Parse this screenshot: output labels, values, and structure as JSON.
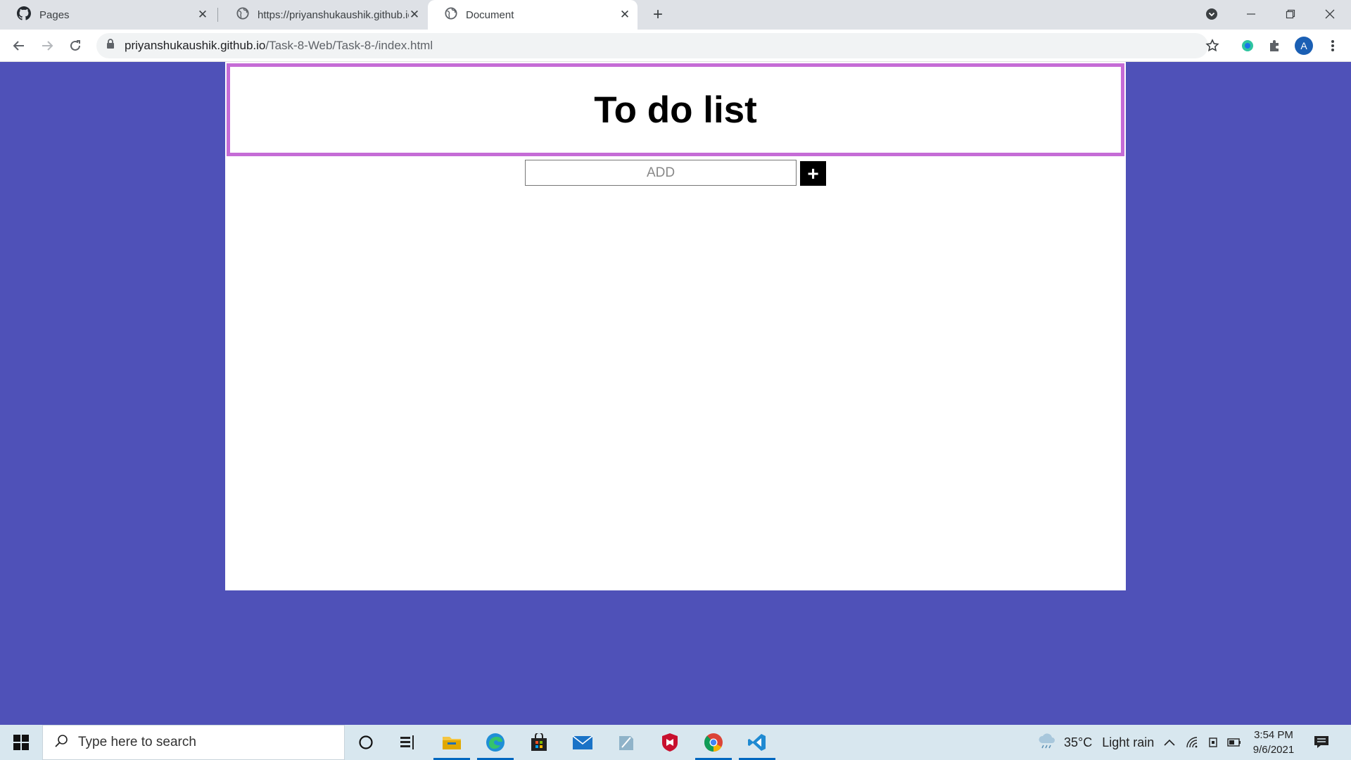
{
  "browser": {
    "tabs": [
      {
        "title": "Pages",
        "icon": "github-icon",
        "active": false
      },
      {
        "title": "https://priyanshukaushik.github.io",
        "icon": "globe-icon",
        "active": false
      },
      {
        "title": "Document",
        "icon": "globe-icon",
        "active": true
      }
    ],
    "url_host": "priyanshukaushik.github.io",
    "url_path": "/Task-8-Web/Task-8-/index.html",
    "profile_initial": "A"
  },
  "page": {
    "title": "To do list",
    "add_placeholder": "ADD",
    "add_button_label": "+",
    "colors": {
      "background": "#4f51b8",
      "header_border": "#c56cd6",
      "button": "#000000"
    }
  },
  "taskbar": {
    "search_placeholder": "Type here to search",
    "weather_temp": "35°C",
    "weather_text": "Light rain",
    "time": "3:54 PM",
    "date": "9/6/2021"
  }
}
